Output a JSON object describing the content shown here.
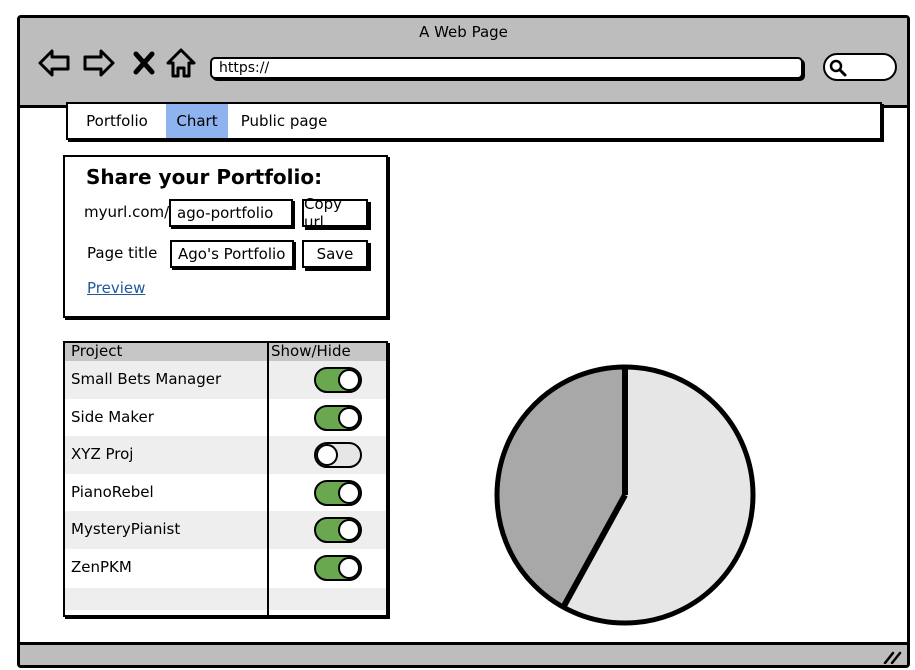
{
  "window": {
    "title": "A Web Page"
  },
  "browser": {
    "url": "https://",
    "nav_icons": [
      "back-arrow-icon",
      "forward-arrow-icon",
      "close-x-icon",
      "home-icon"
    ],
    "search_icon": "search-icon"
  },
  "tabs": [
    {
      "label": "Portfolio",
      "active": false
    },
    {
      "label": "Chart",
      "active": true
    },
    {
      "label": "Public page",
      "active": false
    }
  ],
  "share": {
    "title": "Share your Portfolio:",
    "url_prefix": "myurl.com/",
    "slug_value": "ago-portfolio",
    "copy_label": "Copy url",
    "page_title_label": "Page title",
    "page_title_value": "Ago's Portfolio",
    "save_label": "Save",
    "preview_label": "Preview"
  },
  "projects": {
    "headers": [
      "Project",
      "Show/Hide"
    ],
    "rows": [
      {
        "name": "Small Bets Manager",
        "shown": true
      },
      {
        "name": "Side Maker",
        "shown": true
      },
      {
        "name": "XYZ Proj",
        "shown": false
      },
      {
        "name": "PianoRebel",
        "shown": true
      },
      {
        "name": "MysteryPianist",
        "shown": true
      },
      {
        "name": "ZenPKM",
        "shown": true
      }
    ]
  },
  "chart_data": {
    "type": "pie",
    "slices": [
      {
        "value": 58,
        "color": "#e6e6e6"
      },
      {
        "value": 42,
        "color": "#a8a8a8"
      }
    ]
  },
  "colors": {
    "chrome": "#bdbdbd",
    "active_tab": "#8fb3ee",
    "toggle_on": "#6aa84f",
    "link": "#1e5a99"
  }
}
